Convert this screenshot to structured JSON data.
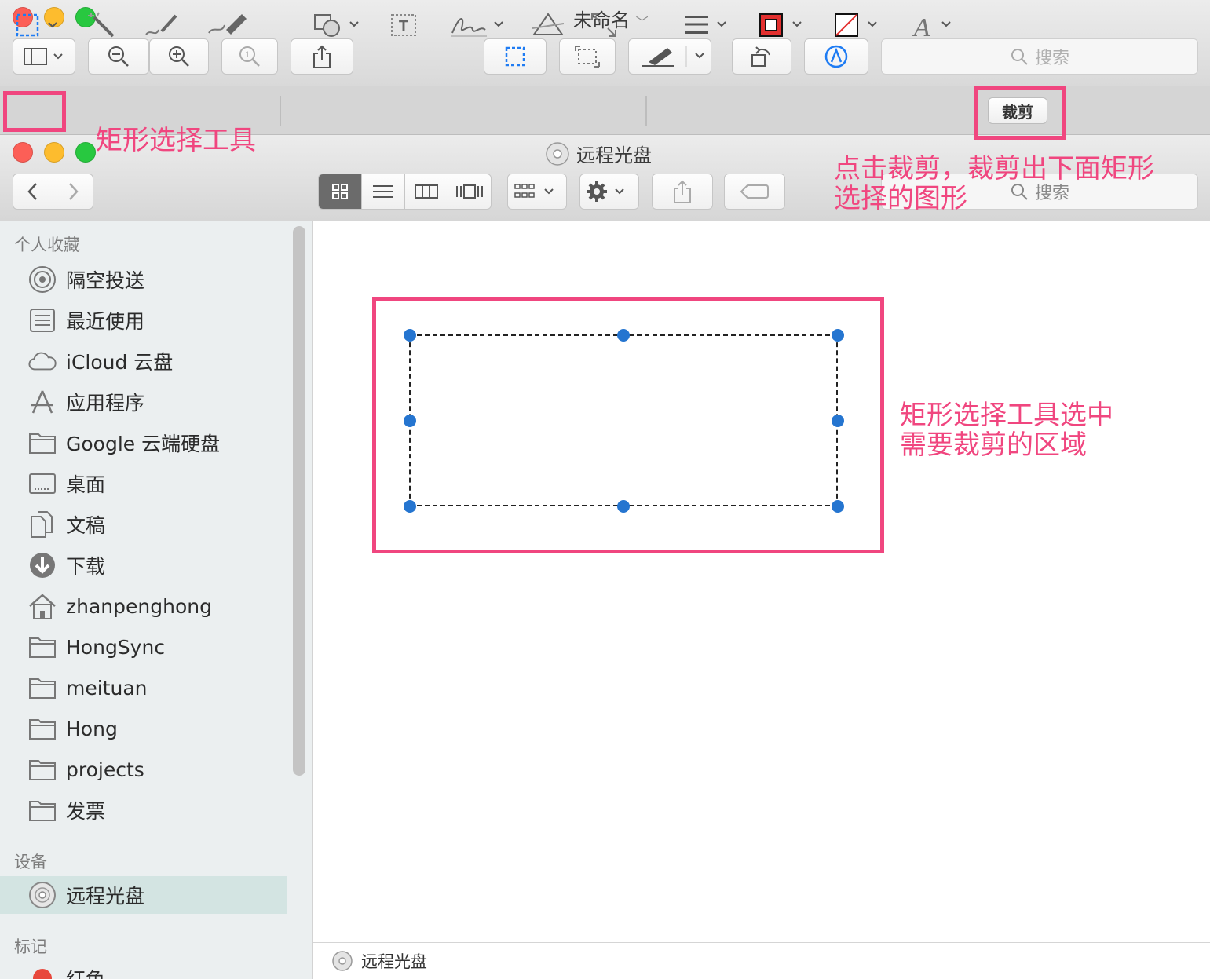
{
  "preview": {
    "title": "未命名",
    "search_placeholder": "搜索",
    "crop_label": "裁剪"
  },
  "finder": {
    "title": "远程光盘",
    "search_placeholder": "搜索",
    "sidebar": {
      "favorites_header": "个人收藏",
      "favorites": [
        {
          "label": "隔空投送",
          "icon": "airdrop-icon"
        },
        {
          "label": "最近使用",
          "icon": "recents-icon"
        },
        {
          "label": "iCloud 云盘",
          "icon": "cloud-icon"
        },
        {
          "label": "应用程序",
          "icon": "applications-icon"
        },
        {
          "label": "Google 云端硬盘",
          "icon": "folder-icon"
        },
        {
          "label": "桌面",
          "icon": "desktop-icon"
        },
        {
          "label": "文稿",
          "icon": "documents-icon"
        },
        {
          "label": "下载",
          "icon": "download-icon"
        },
        {
          "label": "zhanpenghong",
          "icon": "home-icon"
        },
        {
          "label": "HongSync",
          "icon": "folder-icon"
        },
        {
          "label": "meituan",
          "icon": "folder-icon"
        },
        {
          "label": "Hong",
          "icon": "folder-icon"
        },
        {
          "label": "projects",
          "icon": "folder-icon"
        },
        {
          "label": "发票",
          "icon": "folder-icon"
        }
      ],
      "devices_header": "设备",
      "devices": [
        {
          "label": "远程光盘",
          "icon": "disc-icon"
        }
      ],
      "tags_header": "标记",
      "tags": [
        {
          "label": "红色",
          "color": "#e8483c"
        }
      ]
    },
    "path": "远程光盘"
  },
  "annotations": {
    "rect_tool": "矩形选择工具",
    "crop_hint_line1": "点击裁剪，裁剪出下面矩形",
    "crop_hint_line2": "选择的图形",
    "area_hint_line1": "矩形选择工具选中",
    "area_hint_line2": "需要裁剪的区域"
  },
  "colors": {
    "annotation": "#f0467f",
    "selection_handle": "#2575d0",
    "sidebar_selected": "#d3e4e2"
  }
}
